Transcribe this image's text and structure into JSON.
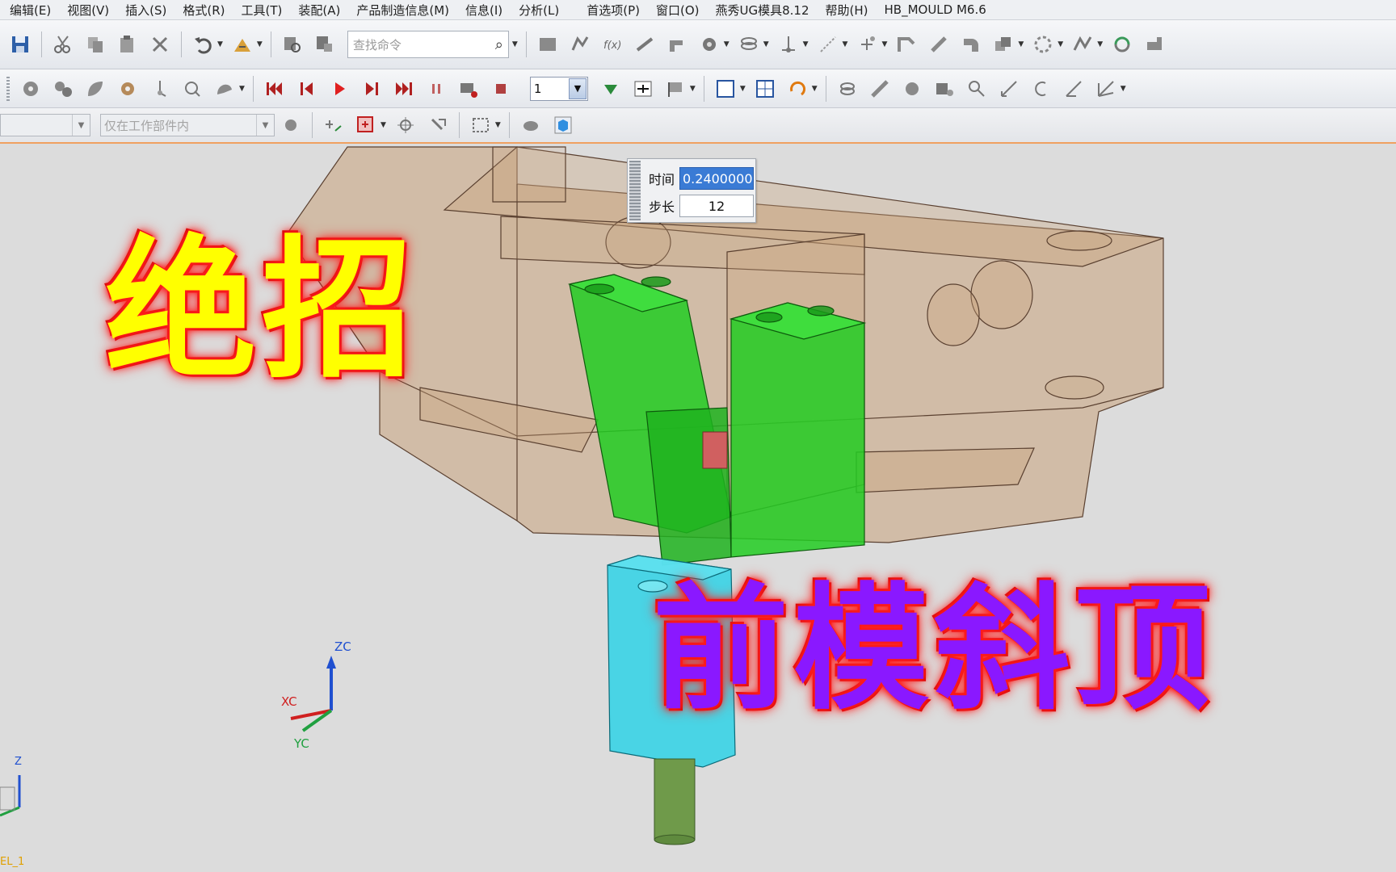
{
  "menu": [
    "编辑(E)",
    "视图(V)",
    "插入(S)",
    "格式(R)",
    "工具(T)",
    "装配(A)",
    "产品制造信息(M)",
    "信息(I)",
    "分析(L)",
    "首选项(P)",
    "窗口(O)",
    "燕秀UG模具8.12",
    "帮助(H)",
    "HB_MOULD M6.6"
  ],
  "toolbar": {
    "search_placeholder": "查找命令",
    "frame_value": "1",
    "filter_combo": "",
    "scope_combo": "仅在工作部件内"
  },
  "animation": {
    "time_label": "时间",
    "time_value": "0.2400000",
    "step_label": "步长",
    "step_value": "12"
  },
  "overlay": {
    "title_top": "绝招",
    "title_bottom": "前模斜顶"
  },
  "axes": {
    "zc": "ZC",
    "xc": "XC",
    "yc": "YC",
    "z_small": "Z"
  },
  "footer": "EL_1",
  "colors": {
    "mold_base": "#c9a27c",
    "lifter": "#22cc22",
    "guide_block": "#2fd2e6",
    "pin": "#6f9a4a",
    "insert_red": "#d06060"
  }
}
